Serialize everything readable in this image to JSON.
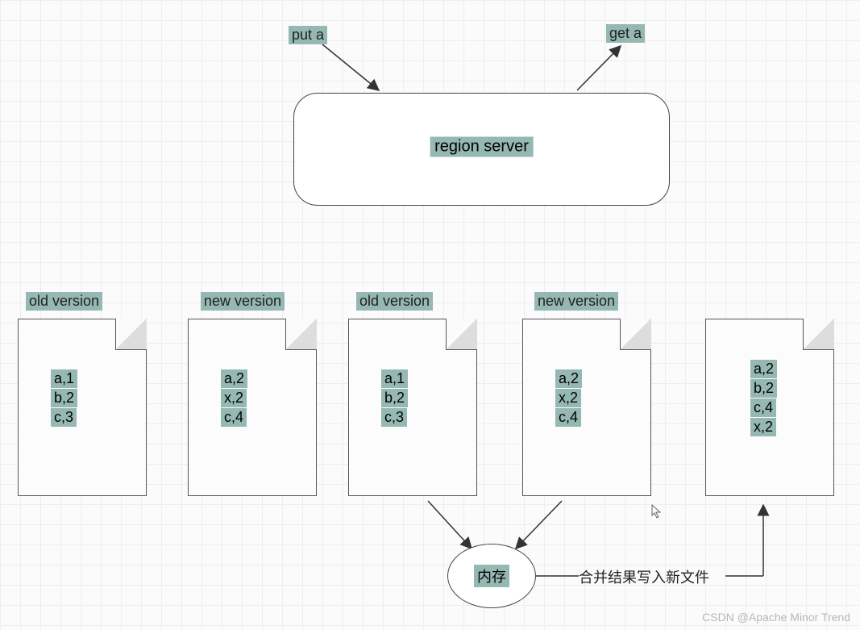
{
  "labels": {
    "put_a": "put a",
    "get_a": "get a",
    "region_server": "region server",
    "memory": "内存",
    "merge_text": "合并结果写入新文件",
    "old_version": "old version",
    "new_version": "new version"
  },
  "docs": [
    {
      "version": "old version",
      "rows": [
        "a,1",
        "b,2",
        "c,3"
      ]
    },
    {
      "version": "new version",
      "rows": [
        "a,2",
        "x,2",
        "c,4"
      ]
    },
    {
      "version": "old version",
      "rows": [
        "a,1",
        "b,2",
        "c,3"
      ]
    },
    {
      "version": "new version",
      "rows": [
        "a,2",
        "x,2",
        "c,4"
      ]
    },
    {
      "version": "",
      "rows": [
        "a,2",
        "b,2",
        "c,4",
        "x,2"
      ]
    }
  ],
  "watermark": "CSDN @Apache Minor Trend"
}
